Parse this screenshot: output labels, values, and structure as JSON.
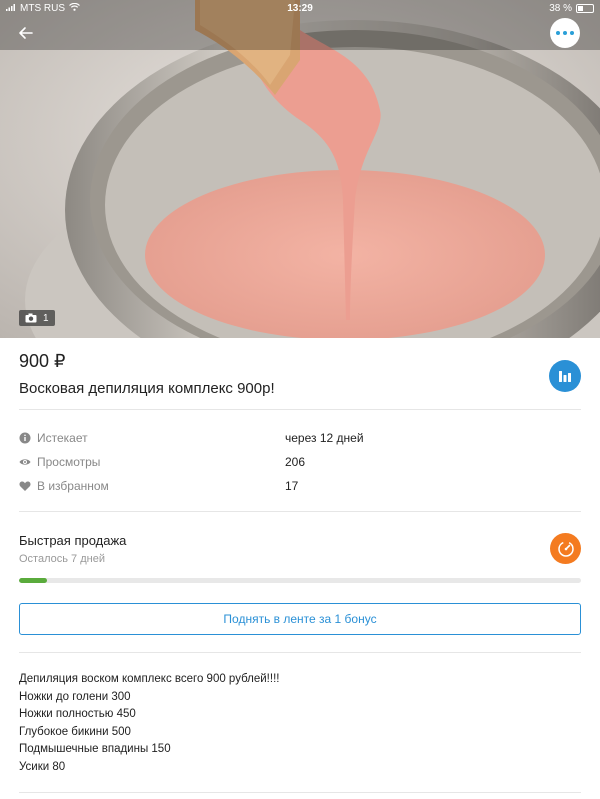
{
  "status_bar": {
    "carrier": "MTS RUS",
    "time": "13:29",
    "battery_text": "38 %",
    "battery_level": 0.38
  },
  "header": {
    "back_icon": "arrow-left-icon",
    "more_icon": "ellipsis-icon"
  },
  "gallery": {
    "photo_count": "1",
    "camera_icon": "camera-icon"
  },
  "listing": {
    "price": "900 ₽",
    "title": "Восковая депиляция комплекс 900р!"
  },
  "info": [
    {
      "icon": "info-icon",
      "label": "Истекает",
      "value": "через 12 дней"
    },
    {
      "icon": "eye-icon",
      "label": "Просмотры",
      "value": "206"
    },
    {
      "icon": "heart-icon",
      "label": "В избранном",
      "value": "17"
    }
  ],
  "quick_sale": {
    "title": "Быстрая продажа",
    "subtitle": "Осталось 7 дней",
    "progress": 0.05
  },
  "raise_button": "Поднять в ленте за 1 бонус",
  "description": [
    "Депиляция воском комплекс всего 900 рублей!!!!",
    "Ножки до голени 300",
    "Ножки полностью 450",
    "Глубокое бикини 500",
    "Подмышечные впадины 150",
    "Усики 80"
  ],
  "colors": {
    "accent": "#2a90d6",
    "quick_sale": "#f47b20",
    "progress": "#5aab3c"
  }
}
